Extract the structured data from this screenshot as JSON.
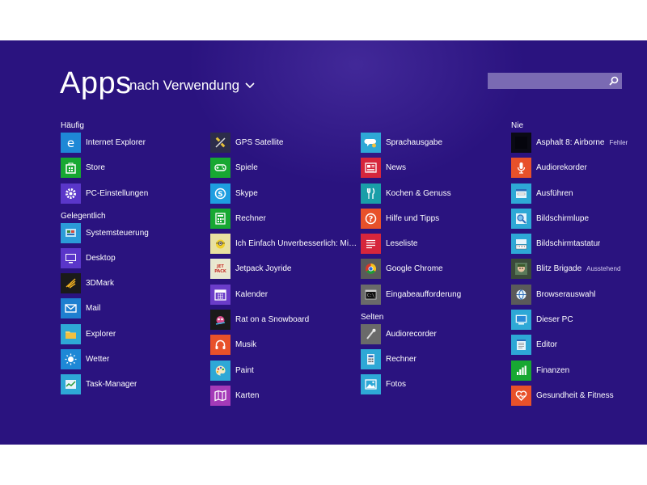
{
  "header": {
    "title": "Apps",
    "sort_label": "nach Verwendung"
  },
  "search": {
    "placeholder": ""
  },
  "columns": [
    {
      "groups": [
        {
          "label": "Häufig",
          "items": [
            {
              "label": "Internet Explorer",
              "icon": "internet-explorer-icon",
              "color": "#1e88d6"
            },
            {
              "label": "Store",
              "icon": "store-icon",
              "color": "#17a832"
            },
            {
              "label": "PC-Einstellungen",
              "icon": "gear-icon",
              "color": "#5a36c9"
            }
          ]
        },
        {
          "label": "Gelegentlich",
          "items": [
            {
              "label": "Systemsteuerung",
              "icon": "control-panel-icon",
              "color": "#2b9bd8"
            },
            {
              "label": "Desktop",
              "icon": "desktop-icon",
              "color": "#5a36c9"
            },
            {
              "label": "3DMark",
              "icon": "3dmark-icon",
              "color": "#1a1a1a"
            },
            {
              "label": "Mail",
              "icon": "mail-icon",
              "color": "#1e7fd0"
            },
            {
              "label": "Explorer",
              "icon": "folder-icon",
              "color": "#2ea8d6"
            },
            {
              "label": "Wetter",
              "icon": "weather-icon",
              "color": "#1e88d6"
            },
            {
              "label": "Task-Manager",
              "icon": "task-manager-icon",
              "color": "#2ea8d6"
            }
          ]
        }
      ]
    },
    {
      "groups": [
        {
          "label": "",
          "items": [
            {
              "label": "GPS Satellite",
              "icon": "satellite-icon",
              "color": "#2c2c4a"
            },
            {
              "label": "Spiele",
              "icon": "gamepad-icon",
              "color": "#17a832"
            },
            {
              "label": "Skype",
              "icon": "skype-icon",
              "color": "#1e9ee0"
            },
            {
              "label": "Rechner",
              "icon": "calculator-icon",
              "color": "#17a832"
            },
            {
              "label": "Ich Einfach Unverbesserlich: Mini...",
              "icon": "minion-game-icon",
              "color": "#e8e0a0"
            },
            {
              "label": "Jetpack Joyride",
              "icon": "jetpack-game-icon",
              "color": "#e8e8d0"
            },
            {
              "label": "Kalender",
              "icon": "calendar-icon",
              "color": "#6a3cc9"
            },
            {
              "label": "Rat on a Snowboard",
              "icon": "rat-game-icon",
              "color": "#1a1a1a"
            },
            {
              "label": "Musik",
              "icon": "headphones-icon",
              "color": "#e8512a"
            },
            {
              "label": "Paint",
              "icon": "paint-palette-icon",
              "color": "#2ea8d6"
            },
            {
              "label": "Karten",
              "icon": "map-icon",
              "color": "#a43ab8"
            }
          ]
        }
      ]
    },
    {
      "groups": [
        {
          "label": "",
          "items": [
            {
              "label": "Sprachausgabe",
              "icon": "narrator-icon",
              "color": "#2ea8d6"
            },
            {
              "label": "News",
              "icon": "news-icon",
              "color": "#d6263c"
            },
            {
              "label": "Kochen & Genuss",
              "icon": "cutlery-icon",
              "color": "#1a9ea8"
            },
            {
              "label": "Hilfe und Tipps",
              "icon": "help-icon",
              "color": "#e8512a"
            },
            {
              "label": "Leseliste",
              "icon": "reading-list-icon",
              "color": "#d6263c"
            },
            {
              "label": "Google Chrome",
              "icon": "chrome-icon",
              "color": "#5a5a5a"
            },
            {
              "label": "Eingabeaufforderung",
              "icon": "command-prompt-icon",
              "color": "#6a6a6a"
            }
          ]
        },
        {
          "label": "Selten",
          "items": [
            {
              "label": "Audiorecorder",
              "icon": "microphone-stand-icon",
              "color": "#6a6a6a"
            },
            {
              "label": "Rechner",
              "icon": "calculator-small-icon",
              "color": "#2ea8d6"
            },
            {
              "label": "Fotos",
              "icon": "photos-icon",
              "color": "#2ea8d6"
            }
          ]
        }
      ]
    },
    {
      "groups": [
        {
          "label": "Nie",
          "items": [
            {
              "label": "Asphalt 8: Airborne",
              "badge": "Fehler",
              "icon": "asphalt-game-icon",
              "color": "#0a0a14"
            },
            {
              "label": "Audiorekorder",
              "icon": "microphone-icon",
              "color": "#e8512a"
            },
            {
              "label": "Ausführen",
              "icon": "run-icon",
              "color": "#2ea8d6"
            },
            {
              "label": "Bildschirmlupe",
              "icon": "magnifier-icon",
              "color": "#2ea8d6"
            },
            {
              "label": "Bildschirmtastatur",
              "icon": "keyboard-icon",
              "color": "#2ea8d6"
            },
            {
              "label": "Blitz Brigade",
              "badge": "Ausstehend",
              "icon": "blitz-game-icon",
              "color": "#3a4a3a"
            },
            {
              "label": "Browserauswahl",
              "icon": "browser-choice-icon",
              "color": "#5a5a5a"
            },
            {
              "label": "Dieser PC",
              "icon": "computer-icon",
              "color": "#2ea8d6"
            },
            {
              "label": "Editor",
              "icon": "notepad-icon",
              "color": "#2ea8d6"
            },
            {
              "label": "Finanzen",
              "icon": "finance-chart-icon",
              "color": "#17a832"
            },
            {
              "label": "Gesundheit & Fitness",
              "icon": "heart-icon",
              "color": "#e8512a"
            }
          ]
        }
      ]
    }
  ]
}
